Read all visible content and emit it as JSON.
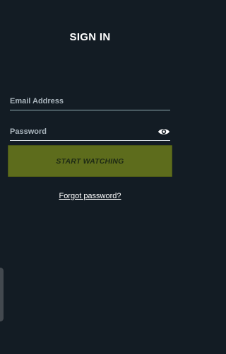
{
  "page": {
    "title": "SIGN IN"
  },
  "form": {
    "email": {
      "placeholder": "Email Address",
      "value": ""
    },
    "password": {
      "placeholder": "Password",
      "value": "",
      "toggle_icon": "eye-icon"
    },
    "submit_label": "START WATCHING",
    "forgot_label": "Forgot password?"
  },
  "colors": {
    "background": "#131c24",
    "button": "#5d6c1c",
    "button_text": "#1e2a14",
    "email_underline": "#8faab1",
    "password_underline": "#dfe6ea"
  }
}
